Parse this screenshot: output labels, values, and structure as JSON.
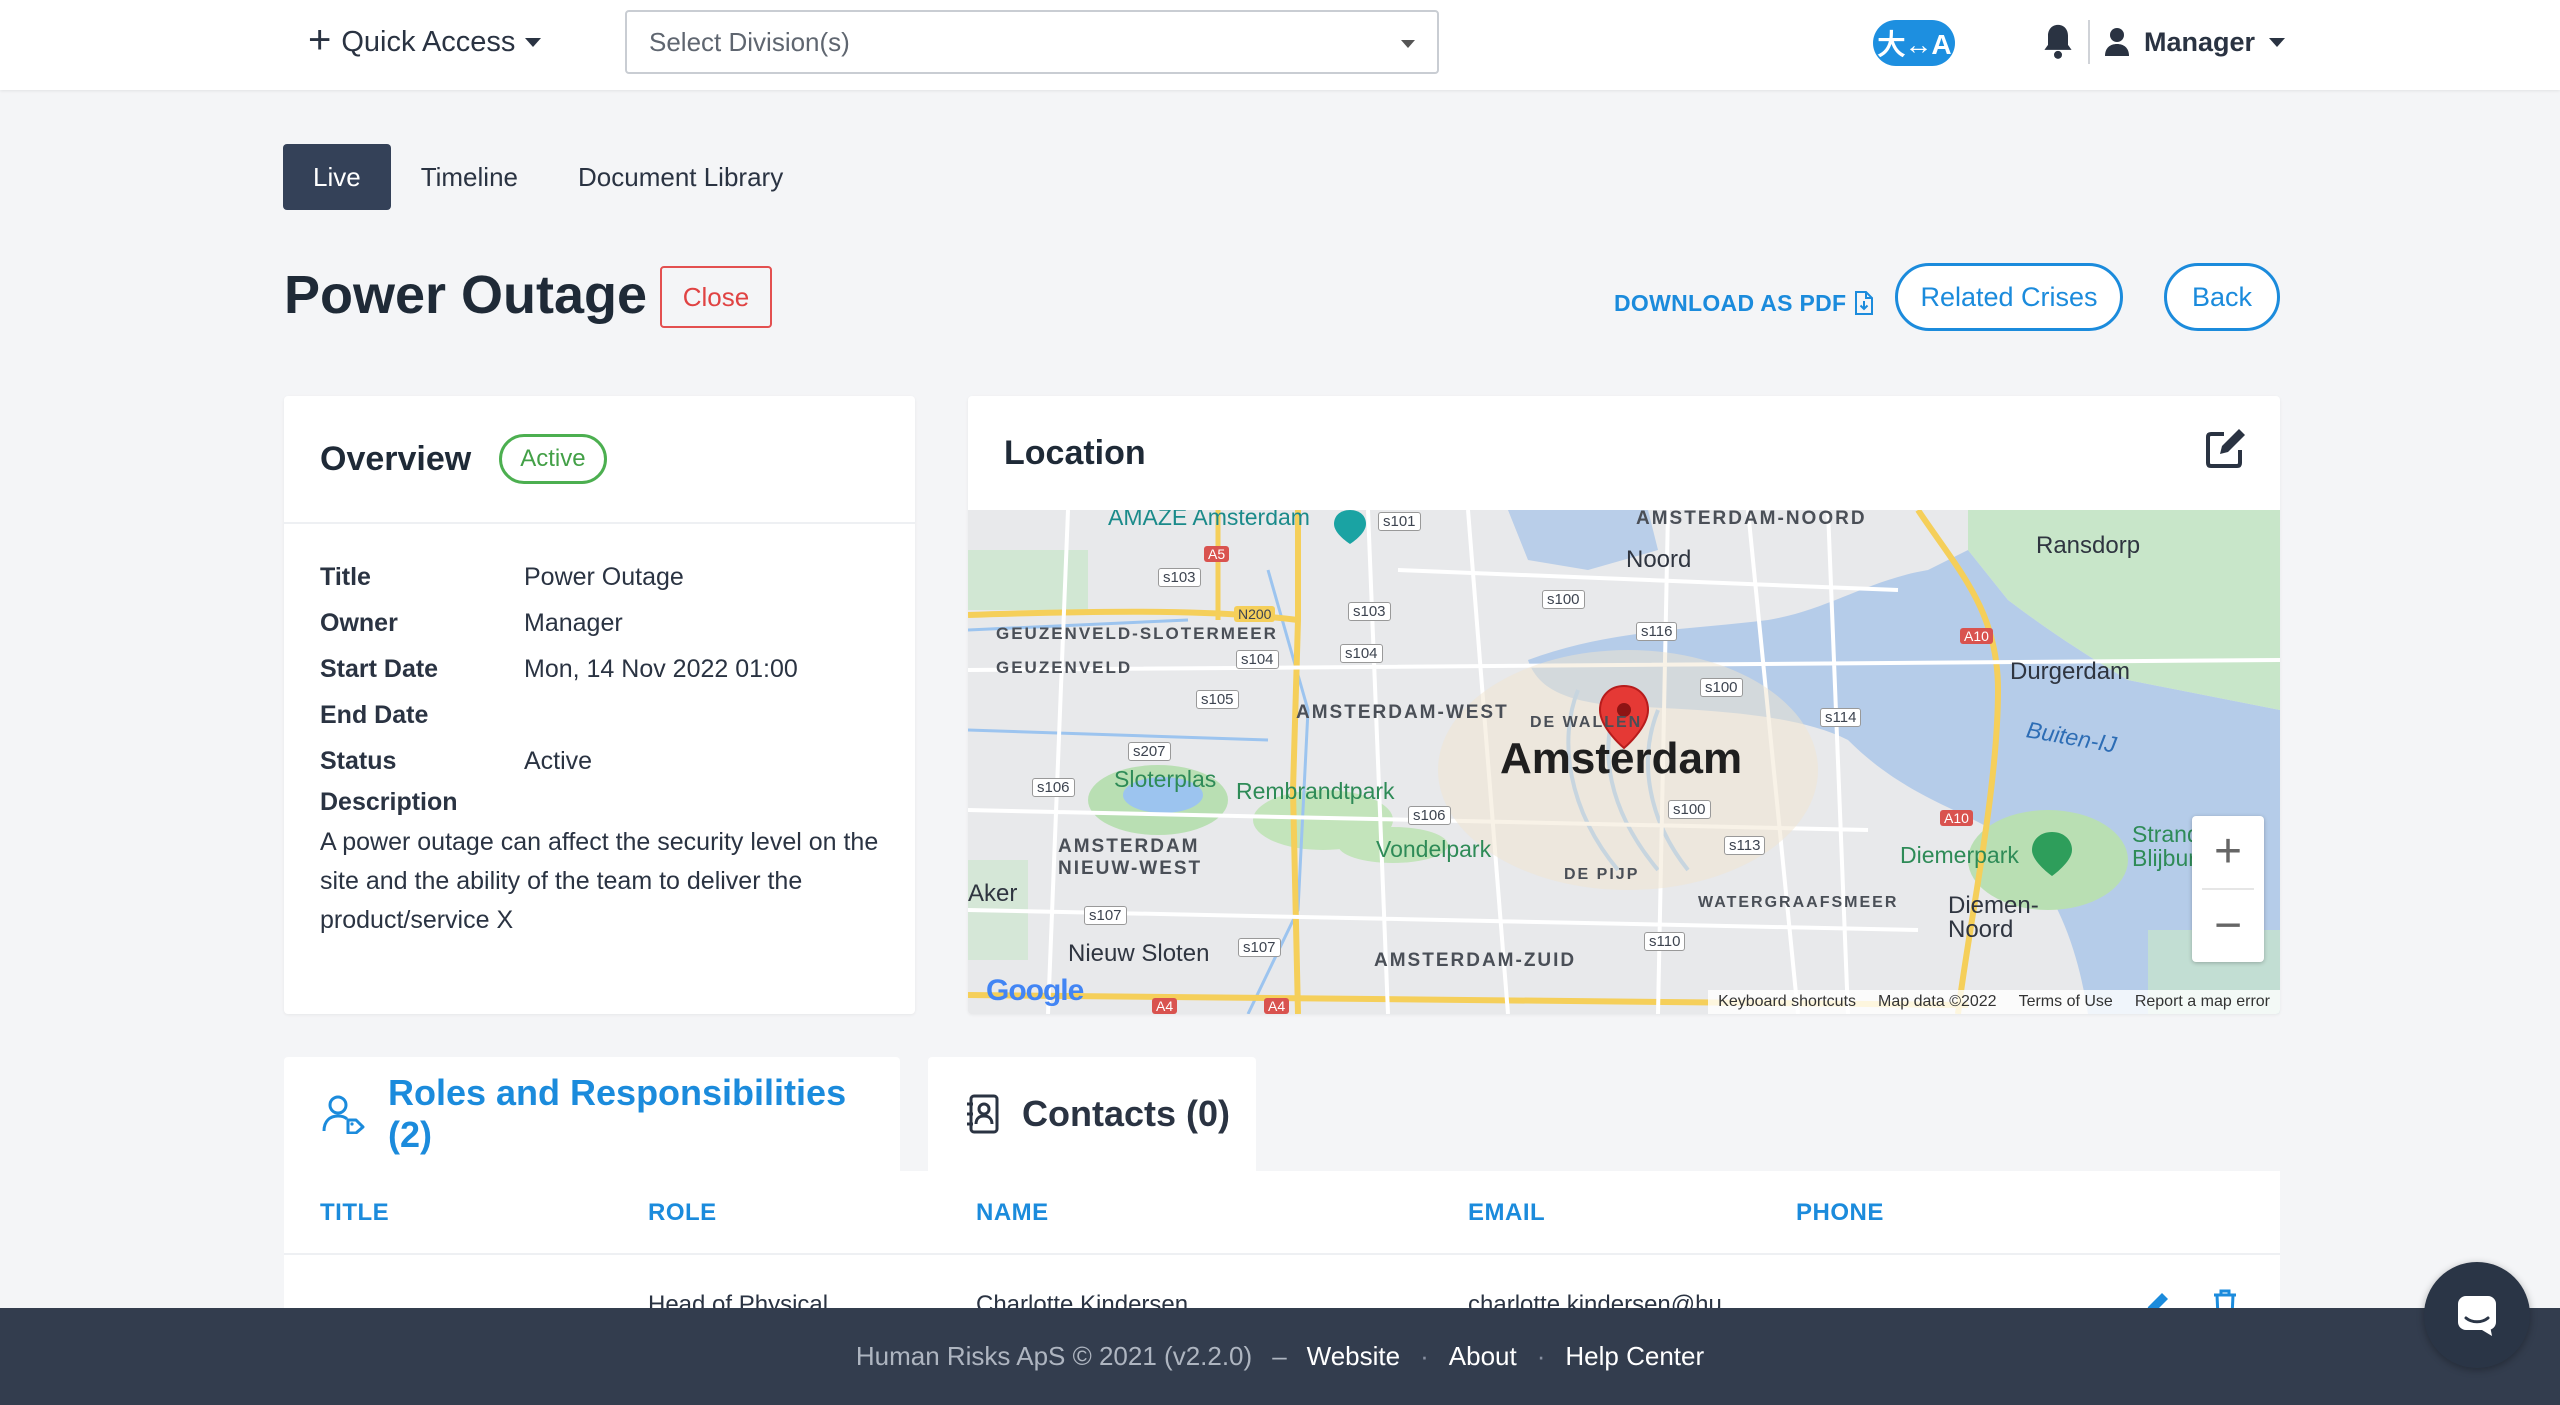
{
  "topbar": {
    "quick_access": "Quick Access",
    "division_placeholder": "Select Division(s)",
    "translate_label": "大↔A",
    "user_name": "Manager"
  },
  "tabs": [
    {
      "label": "Live",
      "active": true
    },
    {
      "label": "Timeline",
      "active": false
    },
    {
      "label": "Document Library",
      "active": false
    }
  ],
  "header": {
    "title": "Power Outage",
    "close_label": "Close",
    "pdf_label": "DOWNLOAD AS PDF",
    "related_label": "Related Crises",
    "back_label": "Back"
  },
  "overview": {
    "heading": "Overview",
    "status_badge": "Active",
    "rows": [
      {
        "label": "Title",
        "value": "Power Outage"
      },
      {
        "label": "Owner",
        "value": "Manager"
      },
      {
        "label": "Start Date",
        "value": "Mon, 14 Nov 2022 01:00"
      },
      {
        "label": "End Date",
        "value": ""
      },
      {
        "label": "Status",
        "value": "Active"
      }
    ],
    "description_label": "Description",
    "description": "A power outage can affect the security level on the site and the ability of the team to deliver the product/service X"
  },
  "location": {
    "heading": "Location",
    "map": {
      "city": "Amsterdam",
      "districts": [
        "AMSTERDAM-NOORD",
        "GEUZENVELD-SLOTERMEER",
        "GEUZENVELD",
        "AMSTERDAM-WEST",
        "DE WALLEN",
        "AMSTERDAM NIEUW-WEST",
        "DE PIJP",
        "WATERGRAAFSMEER",
        "AMSTERDAM-ZUID"
      ],
      "places": [
        "AMAZE Amsterdam",
        "Noord",
        "Ransdorp",
        "Durgerdam",
        "Buiten-IJ",
        "Sloterplas",
        "Rembrandtpark",
        "Vondelpark",
        "Diemerpark",
        "Diemen-Noord",
        "Aker",
        "Nieuw Sloten",
        "Strand Blijburg"
      ],
      "roads": [
        "s101",
        "s103",
        "A5",
        "N200",
        "s103",
        "s104",
        "s104",
        "s105",
        "s207",
        "s106",
        "s106",
        "s107",
        "s107",
        "s100",
        "s116",
        "s100",
        "s114",
        "s100",
        "s113",
        "s110",
        "A10",
        "A10",
        "A4",
        "A4"
      ],
      "attribution": [
        "Keyboard shortcuts",
        "Map data ©2022",
        "Terms of Use",
        "Report a map error"
      ],
      "logo": "Google"
    }
  },
  "sections": {
    "roles_label": "Roles and Responsibilities (2)",
    "contacts_label": "Contacts (0)"
  },
  "table": {
    "columns": [
      "TITLE",
      "ROLE",
      "NAME",
      "EMAIL",
      "PHONE"
    ],
    "first_row": {
      "title": "",
      "role": "Head of Physical",
      "name": "Charlotte Kindersen",
      "email": "charlotte.kindersen@hu",
      "phone": ""
    }
  },
  "footer": {
    "copyright": "Human Risks ApS © 2021 (v2.2.0)",
    "dash": "–",
    "links": [
      "Website",
      "About",
      "Help Center"
    ],
    "dot": "·"
  },
  "colors": {
    "accent": "#1b8bdc",
    "active_tab": "#344158",
    "footer": "#333d4e",
    "status_green": "#43a047",
    "close_red": "#e04343"
  }
}
